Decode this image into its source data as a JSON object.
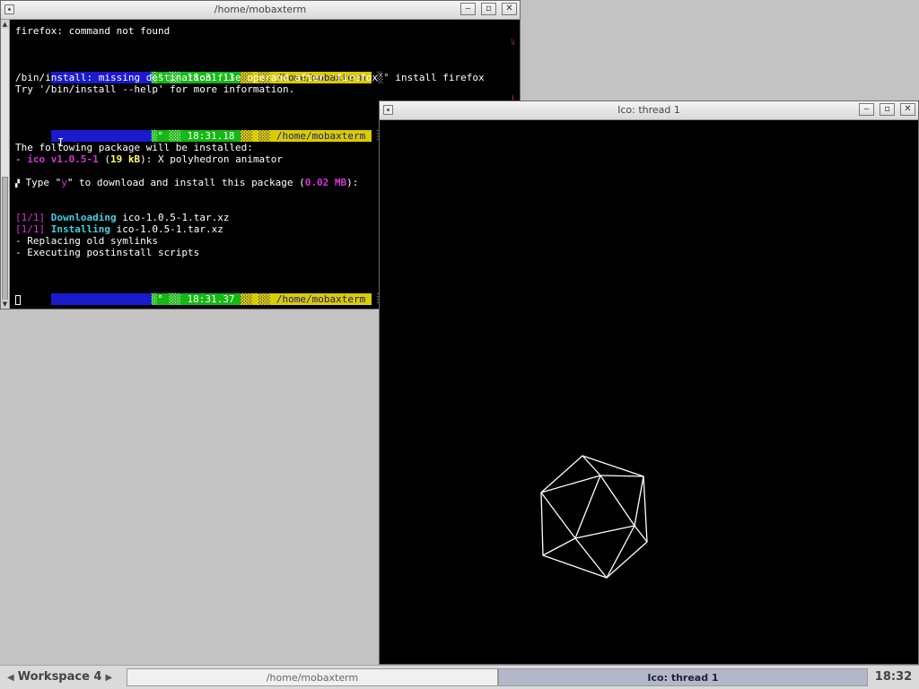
{
  "terminal": {
    "title": "/home/mobaxterm",
    "lines": {
      "l1": "firefox: command not found",
      "p1_time": " 18:31.13 ",
      "p1_path": " /home/mobaxterm ",
      "p1_cmd": "install firefox",
      "l3": "/bin/install: missing destination file operand after 'firefox'",
      "l4": "Try '/bin/install --help' for more information.",
      "p2_time": " 18:31.18 ",
      "p2_path": " /home/mobaxterm ",
      "l6": "The following package will be installed:",
      "pkg_dash": "- ",
      "pkg_name": "ico",
      "pkg_version": " v1.0.5-1",
      "pkg_paren_open": " (",
      "pkg_size": "19 kB",
      "pkg_paren_close": "): X polyhedron animator",
      "prompt_pre": " Type \"",
      "prompt_y": "y",
      "prompt_mid": "\" to download and install this package (",
      "prompt_size": "0.02 MB",
      "prompt_end": "):",
      "dl_tag": "[1/1]",
      "dl_label": " Downloading",
      "dl_file": " ico-1.0.5-1.tar.xz",
      "in_tag": "[1/1]",
      "in_label": " Installing",
      "in_file": " ico-1.0.5-1.tar.xz",
      "l13": "- Replacing old symlinks",
      "l14": "- Executing postinstall scripts",
      "p3_time": " 18:31.37 ",
      "p3_path": " /home/mobaxterm "
    }
  },
  "ico_window": {
    "title": "Ico: thread 1"
  },
  "taskbar": {
    "workspace": "Workspace 4",
    "task_terminal": "/home/mobaxterm",
    "task_ico": "Ico: thread 1",
    "clock": "18:32"
  },
  "icons": [
    "window-menu-icon",
    "minimize-icon",
    "maximize-icon",
    "close-icon",
    "prev-workspace-icon",
    "next-workspace-icon"
  ],
  "colors": {
    "prompt_blue": "#1a1acf",
    "prompt_green": "#15b815",
    "prompt_yellow": "#d9cc00",
    "accent_magenta": "#d633d6",
    "accent_cyan": "#3fd0e0"
  }
}
